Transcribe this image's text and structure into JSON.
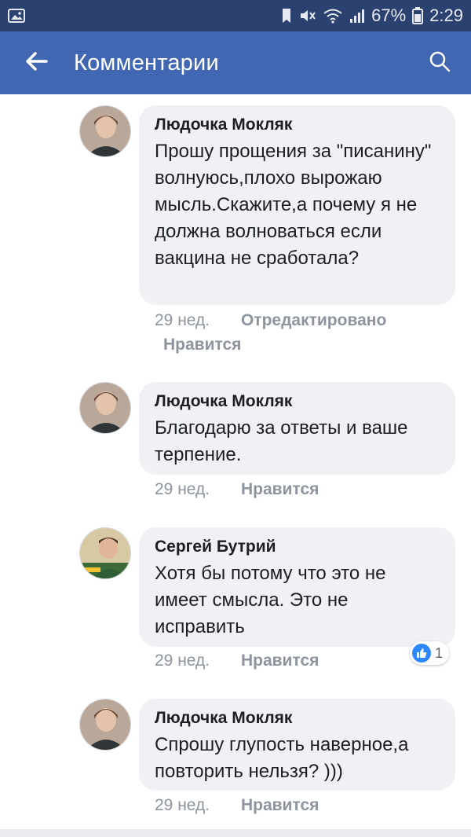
{
  "status_bar": {
    "battery": "67%",
    "time": "2:29",
    "icons": [
      "gallery-icon",
      "save-icon",
      "mute-icon",
      "wifi-icon",
      "signal-icon",
      "battery-icon"
    ]
  },
  "app_bar": {
    "title": "Комментарии",
    "icons": [
      "back-arrow-icon",
      "search-icon"
    ]
  },
  "comments": [
    {
      "author": "Людочка Мокляк",
      "text": "Прошу прощения за \"писанину\" волнуюсь,плохо вырожаю мысль.Скажите,а почему я не должна волноваться если вакцина не сработала?",
      "time": "29 нед.",
      "edited": "Отредактировано",
      "like": "Нравится"
    },
    {
      "author": "Людочка Мокляк",
      "text": "Благодарю за ответы и ваше терпение.",
      "time": "29 нед.",
      "like": "Нравится"
    },
    {
      "author": "Сергей Бутрий",
      "text": "Хотя бы потому что это не имеет смысла. Это не исправить",
      "time": "29 нед.",
      "like": "Нравится",
      "reaction_count": "1"
    },
    {
      "author": "Людочка Мокляк",
      "text": "Спрошу глупость наверное,а повторить нельзя? )))",
      "time": "29 нед.",
      "like": "Нравится"
    }
  ],
  "colors": {
    "status_bar": "#2b4170",
    "app_bar": "#4267b2",
    "bubble": "#f0f1f4",
    "meta_text": "#8d949e",
    "like_reaction": "#2d88ff"
  }
}
